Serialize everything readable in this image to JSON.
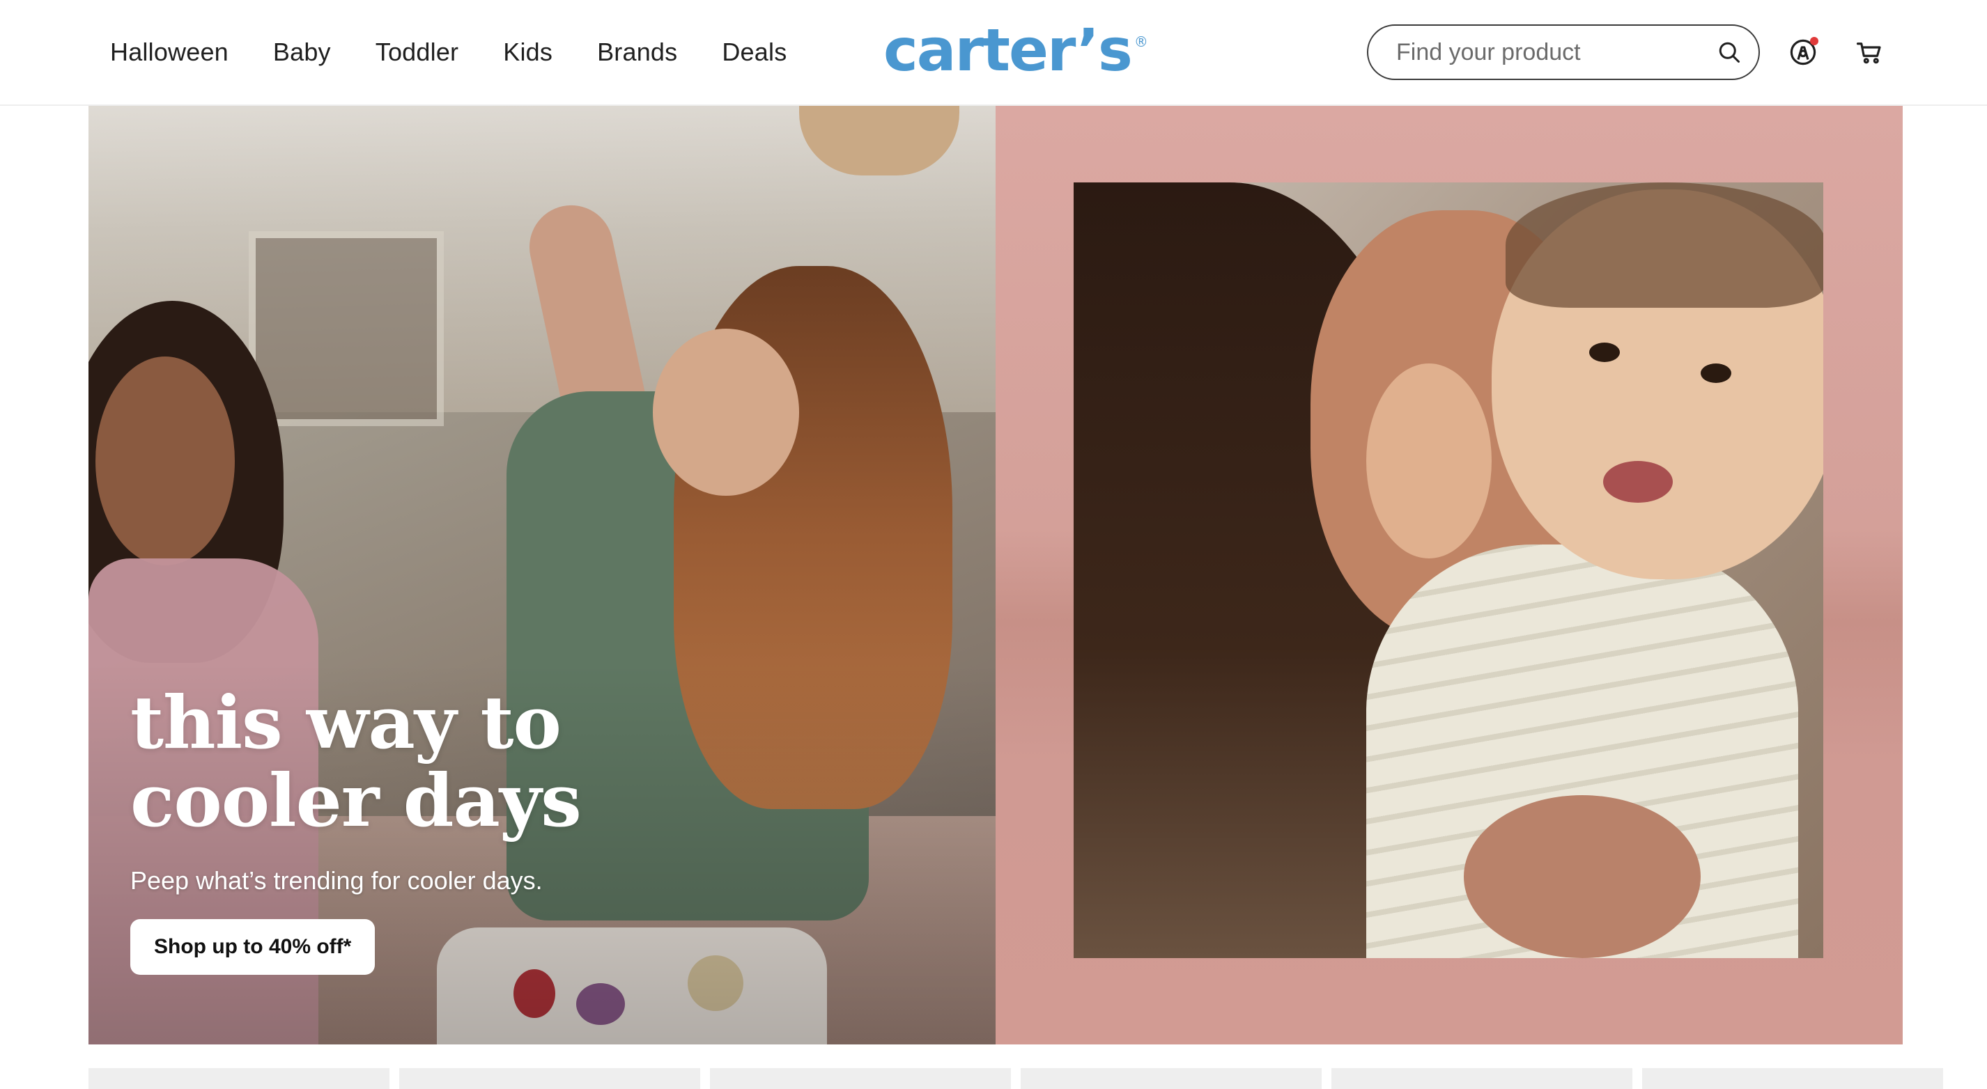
{
  "header": {
    "nav": [
      {
        "label": "Halloween"
      },
      {
        "label": "Baby"
      },
      {
        "label": "Toddler"
      },
      {
        "label": "Kids"
      },
      {
        "label": "Brands"
      },
      {
        "label": "Deals"
      }
    ],
    "logo": {
      "text": "carter’s",
      "mark": "®"
    },
    "search": {
      "placeholder": "Find your product",
      "value": "",
      "icon": "search-icon"
    },
    "account_icon": "account-icon",
    "cart_icon": "cart-icon",
    "notification_color": "#e03a3a"
  },
  "hero": {
    "left": {
      "title_line1": "this way to",
      "title_line2": "cooler days",
      "subtitle": "Peep what’s trending for cooler days.",
      "cta_label": "Shop up to 40% off*"
    },
    "right": {
      "background_color": "#d4a099"
    }
  },
  "colors": {
    "brand": "#4a97d0",
    "text": "#1f1f1f"
  }
}
